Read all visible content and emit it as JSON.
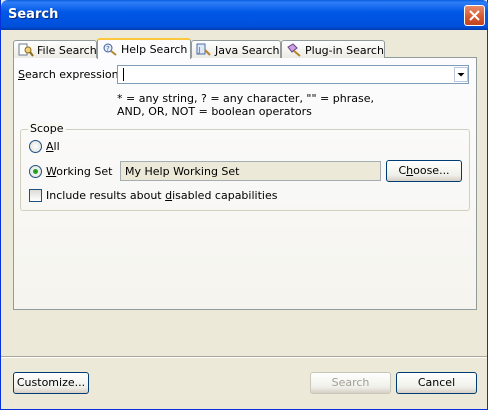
{
  "window": {
    "title": "Search"
  },
  "tabs": [
    {
      "label": "File Search",
      "icon": "file-search-icon"
    },
    {
      "label": "Help Search",
      "icon": "help-search-icon",
      "active": true
    },
    {
      "label": "Java Search",
      "icon": "java-search-icon"
    },
    {
      "label": "Plug-in Search",
      "icon": "plugin-search-icon"
    }
  ],
  "expression": {
    "label_pre": "S",
    "label_rest": "earch expression:",
    "value": ""
  },
  "hint": {
    "line1": "* = any string, ? = any character, \"\" = phrase,",
    "line2": "AND, OR, NOT = boolean operators"
  },
  "scope": {
    "legend": "Scope",
    "all_label_u": "A",
    "all_label_rest": "ll",
    "working_set_label_u": "W",
    "working_set_label_rest": "orking Set",
    "working_set_selected": true,
    "working_set_value": "My Help Working Set",
    "choose_label_pre": "C",
    "choose_label_u": "h",
    "choose_label_rest": "oose...",
    "include_label_pre": "Include results about ",
    "include_label_u": "d",
    "include_label_rest": "isabled capabilities",
    "include_checked": false
  },
  "footer": {
    "customize_label": "Customize...",
    "search_label": "Search",
    "search_enabled": false,
    "cancel_label": "Cancel"
  },
  "colors": {
    "title_bar": "#0058e6",
    "window_bg": "#ece9d8",
    "radio_dot": "#21a121",
    "tab_highlight": "#ffc83c"
  }
}
